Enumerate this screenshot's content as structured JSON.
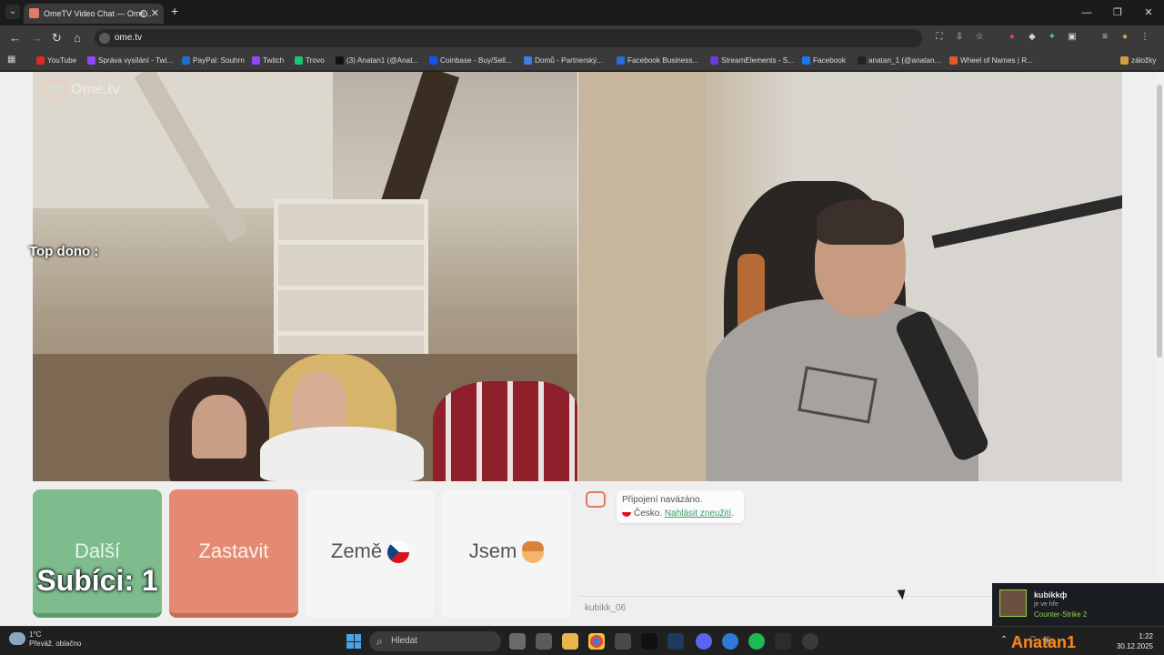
{
  "browser": {
    "tab_title": "OmeTV Video Chat — Ome...",
    "url": "ome.tv",
    "bookmarks": [
      {
        "label": "YouTube",
        "color": "#e02828"
      },
      {
        "label": "Správa vysílání - Twi...",
        "color": "#9147ff"
      },
      {
        "label": "PayPal: Souhrn",
        "color": "#1f6fd1"
      },
      {
        "label": "Twitch",
        "color": "#9147ff"
      },
      {
        "label": "Trovo",
        "color": "#1ec47a"
      },
      {
        "label": "(3) Anatan1 (@Anat...",
        "color": "#111111"
      },
      {
        "label": "Coinbase - Buy/Sell...",
        "color": "#1652f0"
      },
      {
        "label": "Domů - Partnerský...",
        "color": "#3b7fe0"
      },
      {
        "label": "Facebook Business...",
        "color": "#2d6adb"
      },
      {
        "label": "StreamElements - S...",
        "color": "#6a3dd6"
      },
      {
        "label": "Facebook",
        "color": "#1877f2"
      },
      {
        "label": "anatan_1 (@anatan...",
        "color": "#222222"
      },
      {
        "label": "Wheel of Names | R...",
        "color": "#e05a2a"
      },
      {
        "label": "záložky",
        "color": "#d0a040"
      }
    ]
  },
  "app": {
    "logo_text": "Ome.tv",
    "overlay_top_dono": "Top dono :",
    "overlay_subs": "Subíci: 1",
    "buttons": {
      "next": "Další",
      "stop": "Zastavit",
      "country": "Země",
      "gender": "Jsem"
    },
    "chat": {
      "connected": "Připojení navázáno.",
      "country": "Česko.",
      "report_link": "Nahlásit zneužití",
      "username": "kubikk_06"
    }
  },
  "notification": {
    "name": "kubikkф",
    "status": "je ve hře",
    "game": "Counter-Strike 2"
  },
  "taskbar": {
    "temperature": "1°C",
    "weather": "Převáž. oblačno",
    "search_placeholder": "Hledat",
    "time": "1:22",
    "date": "30.12.2025"
  },
  "watermark": "Anatan1"
}
